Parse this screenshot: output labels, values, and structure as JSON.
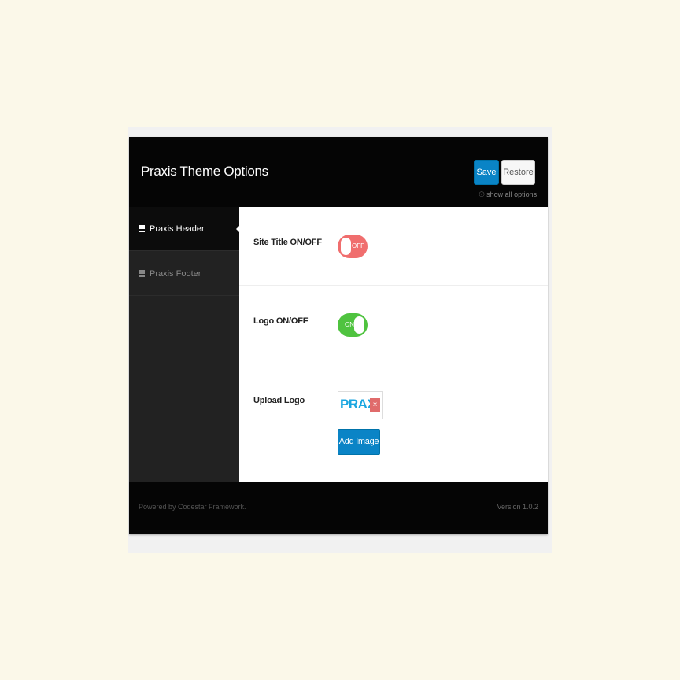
{
  "header": {
    "title": "Praxis Theme Options",
    "save_label": "Save",
    "restore_label": "Restore",
    "show_all_label": "show all options"
  },
  "sidebar": {
    "items": [
      {
        "label": "Praxis Header",
        "active": true,
        "icon": "list-icon"
      },
      {
        "label": "Praxis Footer",
        "active": false,
        "icon": "list-icon"
      }
    ]
  },
  "fields": {
    "site_title": {
      "label": "Site Title ON/OFF",
      "state": "OFF"
    },
    "logo": {
      "label": "Logo ON/OFF",
      "state": "ON"
    },
    "upload_logo": {
      "label": "Upload Logo",
      "preview_text": "PRAX",
      "preview_remove_glyph": "×",
      "button_label": "Add Image"
    }
  },
  "footer": {
    "powered_by": "Powered by Codestar Framework.",
    "version": "Version 1.0.2"
  },
  "colors": {
    "accent": "#0a84c6",
    "toggle_off": "#f06e6e",
    "toggle_on": "#4fc33f",
    "header_bg": "#050505",
    "sidebar_bg": "#222222"
  }
}
